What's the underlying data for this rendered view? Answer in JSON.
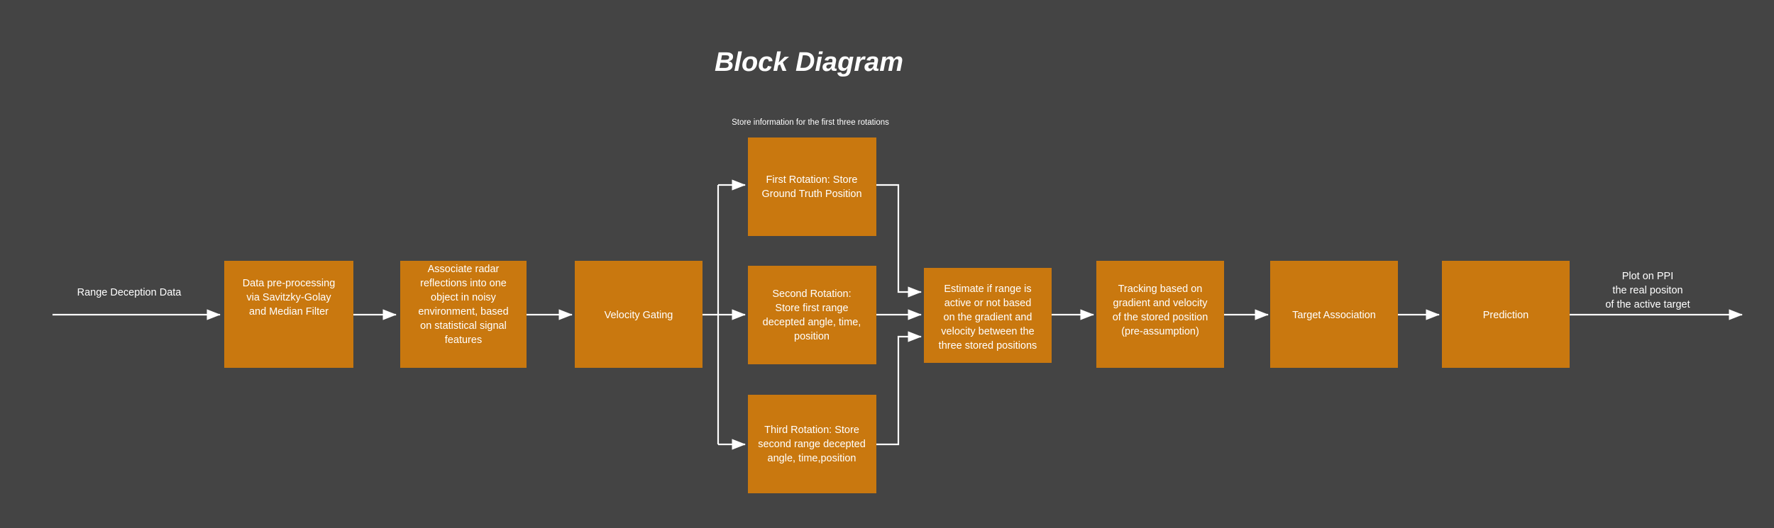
{
  "page": {
    "title": "Block Diagram",
    "background_color": "#444444",
    "box_color": "#C9780F",
    "connector_color": "#ffffff",
    "text_color": "#ffffff"
  },
  "annotations": {
    "rotations_note": "Store information for the first three rotations",
    "input_label": "Range Deception Data",
    "output_label_line1": "Plot on PPI",
    "output_label_line2": "the real positon",
    "output_label_line3": "of the active target"
  },
  "nodes": {
    "preprocessing": {
      "lines": [
        "Data pre-processing",
        "via Savitzky-Golay",
        "and Median Filter"
      ]
    },
    "association": {
      "lines": [
        "Associate radar",
        "reflections into one",
        "object in noisy",
        "environment, based",
        "on statistical signal",
        "features"
      ]
    },
    "velocity_gating": {
      "lines": [
        "Velocity Gating"
      ]
    },
    "first_rotation": {
      "lines": [
        "First Rotation: Store",
        "Ground Truth Position"
      ]
    },
    "second_rotation": {
      "lines": [
        "Second Rotation:",
        "Store first range",
        "decepted angle, time,",
        "position"
      ]
    },
    "third_rotation": {
      "lines": [
        "Third Rotation: Store",
        "second range decepted",
        "angle, time,position"
      ]
    },
    "estimate": {
      "lines": [
        "Estimate if range is",
        "active or not based",
        "on the gradient and",
        "velocity between the",
        "three stored positions"
      ]
    },
    "tracking": {
      "lines": [
        "Tracking based on",
        "gradient and velocity",
        "of the stored position",
        "(pre-assumption)"
      ]
    },
    "target_association": {
      "lines": [
        "Target Association"
      ]
    },
    "prediction": {
      "lines": [
        "Prediction"
      ]
    }
  }
}
